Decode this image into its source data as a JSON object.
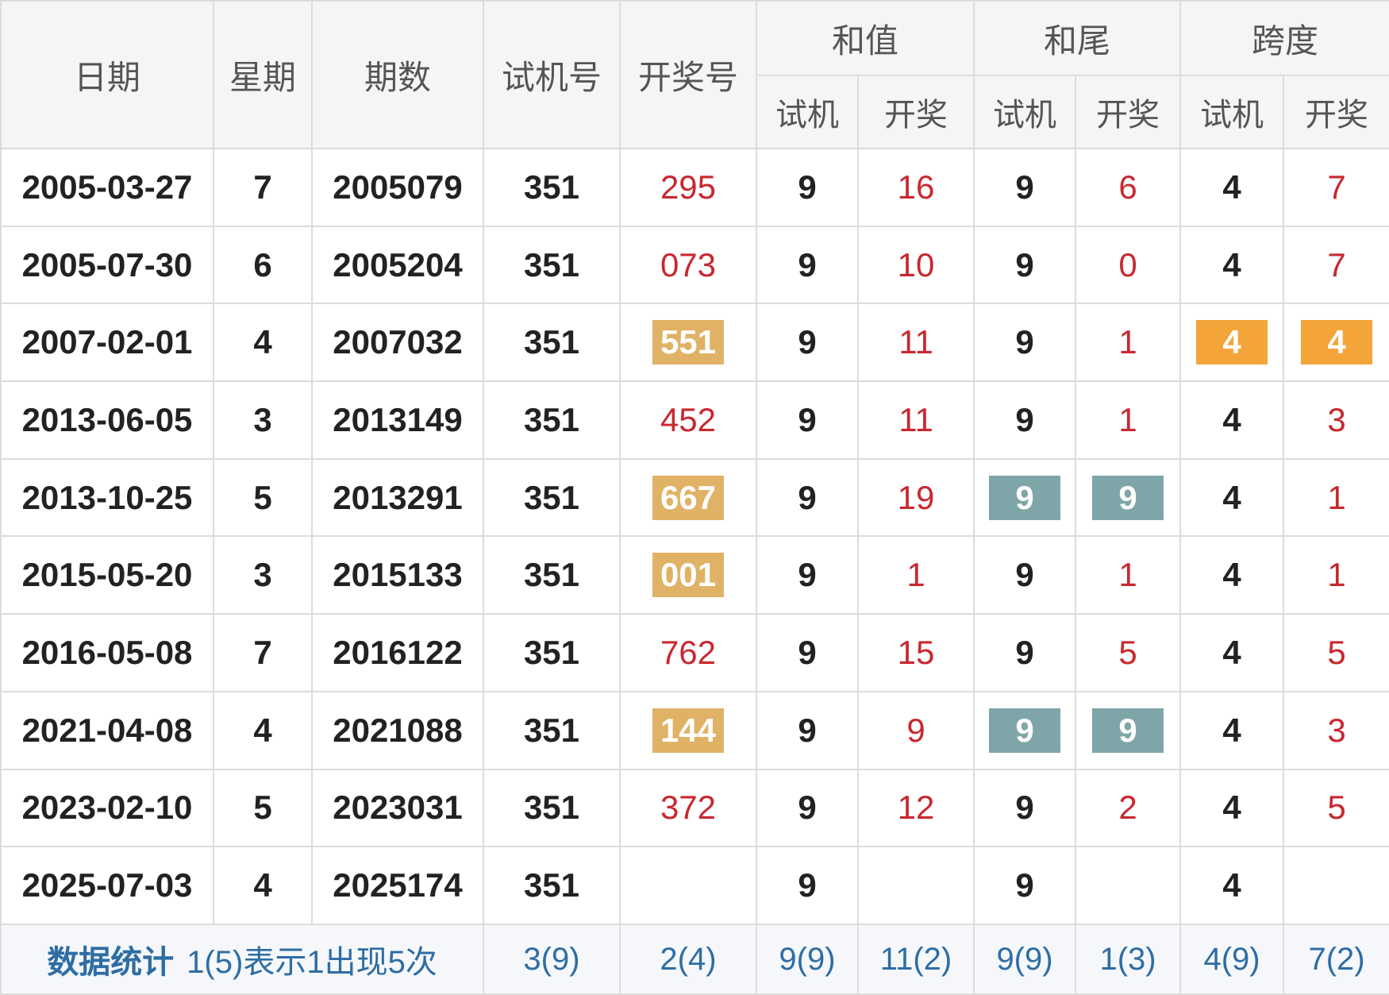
{
  "header": {
    "date": "日期",
    "weekday": "星期",
    "issue": "期数",
    "test_no": "试机号",
    "draw_no": "开奖号",
    "sum_group": "和值",
    "tail_group": "和尾",
    "span_group": "跨度",
    "sub_test": "试机",
    "sub_draw": "开奖"
  },
  "rows": [
    {
      "date": "2005-03-27",
      "weekday": "7",
      "issue": "2005079",
      "test": "351",
      "draw": "295",
      "sum_test": "9",
      "sum_draw": "16",
      "tail_test": "9",
      "tail_draw": "6",
      "span_test": "4",
      "span_draw": "7"
    },
    {
      "date": "2005-07-30",
      "weekday": "6",
      "issue": "2005204",
      "test": "351",
      "draw": "073",
      "sum_test": "9",
      "sum_draw": "10",
      "tail_test": "9",
      "tail_draw": "0",
      "span_test": "4",
      "span_draw": "7"
    },
    {
      "date": "2007-02-01",
      "weekday": "4",
      "issue": "2007032",
      "test": "351",
      "draw": "551",
      "sum_test": "9",
      "sum_draw": "11",
      "tail_test": "9",
      "tail_draw": "1",
      "span_test": "4",
      "span_draw": "4"
    },
    {
      "date": "2013-06-05",
      "weekday": "3",
      "issue": "2013149",
      "test": "351",
      "draw": "452",
      "sum_test": "9",
      "sum_draw": "11",
      "tail_test": "9",
      "tail_draw": "1",
      "span_test": "4",
      "span_draw": "3"
    },
    {
      "date": "2013-10-25",
      "weekday": "5",
      "issue": "2013291",
      "test": "351",
      "draw": "667",
      "sum_test": "9",
      "sum_draw": "19",
      "tail_test": "9",
      "tail_draw": "9",
      "span_test": "4",
      "span_draw": "1"
    },
    {
      "date": "2015-05-20",
      "weekday": "3",
      "issue": "2015133",
      "test": "351",
      "draw": "001",
      "sum_test": "9",
      "sum_draw": "1",
      "tail_test": "9",
      "tail_draw": "1",
      "span_test": "4",
      "span_draw": "1"
    },
    {
      "date": "2016-05-08",
      "weekday": "7",
      "issue": "2016122",
      "test": "351",
      "draw": "762",
      "sum_test": "9",
      "sum_draw": "15",
      "tail_test": "9",
      "tail_draw": "5",
      "span_test": "4",
      "span_draw": "5"
    },
    {
      "date": "2021-04-08",
      "weekday": "4",
      "issue": "2021088",
      "test": "351",
      "draw": "144",
      "sum_test": "9",
      "sum_draw": "9",
      "tail_test": "9",
      "tail_draw": "9",
      "span_test": "4",
      "span_draw": "3"
    },
    {
      "date": "2023-02-10",
      "weekday": "5",
      "issue": "2023031",
      "test": "351",
      "draw": "372",
      "sum_test": "9",
      "sum_draw": "12",
      "tail_test": "9",
      "tail_draw": "2",
      "span_test": "4",
      "span_draw": "5"
    },
    {
      "date": "2025-07-03",
      "weekday": "4",
      "issue": "2025174",
      "test": "351",
      "draw": "",
      "sum_test": "9",
      "sum_draw": "",
      "tail_test": "9",
      "tail_draw": "",
      "span_test": "4",
      "span_draw": ""
    }
  ],
  "highlight_colors": {
    "tan": "#e0b265",
    "orange": "#f3a53a",
    "teal": "#7ea6a8",
    "red_text": "#c8282f",
    "stats_blue": "#2e6da4"
  },
  "stats": {
    "label": "数据统计",
    "note": "1(5)表示1出现5次",
    "test": "3(9)",
    "draw": "2(4)",
    "sum_test": "9(9)",
    "sum_draw": "11(2)",
    "tail_test": "9(9)",
    "tail_draw": "1(3)",
    "span_test": "4(9)",
    "span_draw": "7(2)"
  }
}
